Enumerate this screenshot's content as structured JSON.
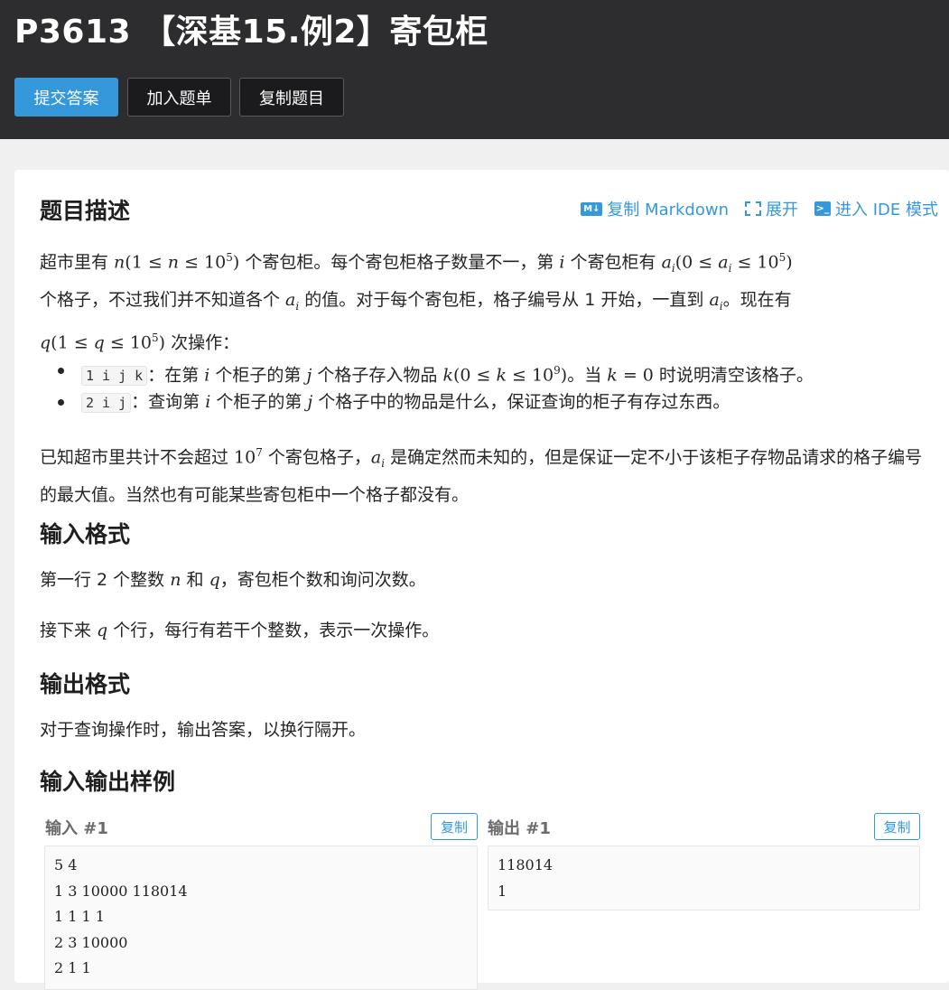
{
  "header": {
    "title": "P3613 【深基15.例2】寄包柜",
    "buttons": {
      "submit": "提交答案",
      "add_list": "加入题单",
      "copy_problem": "复制题目"
    }
  },
  "toolbar": {
    "copy_markdown": "复制 Markdown",
    "expand": "展开",
    "ide_mode": "进入 IDE 模式",
    "md_icon_text": "M↓",
    "term_icon_text": ">_"
  },
  "sections": {
    "description": "题目描述",
    "input_format": "输入格式",
    "output_format": "输出格式",
    "samples": "输入输出样例"
  },
  "description": {
    "p1": {
      "a": "超市里有 ",
      "n1": "n",
      "r1": "(1 ≤ ",
      "n2": "n",
      "r2": " ≤ 10",
      "exp1": "5",
      "r3": ")",
      "b": " 个寄包柜。每个寄包柜格子数量不一，第 ",
      "i": "i",
      "c": " 个寄包柜有 ",
      "ai": "a",
      "sub_i": "i",
      "r4": "(0 ≤ ",
      "ai2": "a",
      "sub_i2": "i",
      "r5": " ≤ 10",
      "exp2": "5",
      "r6": ")",
      "d": "个格子，不过我们并不知道各个 ",
      "ai3": "a",
      "sub_i3": "i",
      "e": " 的值。对于每个寄包柜，格子编号从 1 开始，一直到 ",
      "ai4": "a",
      "sub_i4": "i",
      "f": "。现在有",
      "q1": "q",
      "r7": "(1 ≤ ",
      "q2": "q",
      "r8": " ≤ 10",
      "exp3": "5",
      "r9": ")",
      "g": " 次操作："
    },
    "bullets": [
      {
        "code": "1 i j k",
        "a": "：在第 ",
        "v1": "i",
        "b": " 个柜子的第 ",
        "v2": "j",
        "c": " 个格子存入物品 ",
        "v3": "k",
        "r1": "(0 ≤ ",
        "v4": "k",
        "r2": " ≤ 10",
        "exp": "9",
        "r3": ")",
        "d": "。当 ",
        "v5": "k",
        "r4": " = 0",
        "e": " 时说明清空该格子。"
      },
      {
        "code": "2 i j",
        "a": "：查询第 ",
        "v1": "i",
        "b": " 个柜子的第 ",
        "v2": "j",
        "c": " 个格子中的物品是什么，保证查询的柜子有存过东西。"
      }
    ],
    "p2": {
      "a": "已知超市里共计不会超过 ",
      "base": "10",
      "exp": "7",
      "b": " 个寄包格子，",
      "ai": "a",
      "sub": "i",
      "c": " 是确定然而未知的，但是保证一定不小于该柜子存物品请求的格子编号的最大值。当然也有可能某些寄包柜中一个格子都没有。"
    }
  },
  "input_format": {
    "l1": {
      "a": "第一行 2 个整数 ",
      "n": "n",
      "b": " 和 ",
      "q": "q",
      "c": "，寄包柜个数和询问次数。"
    },
    "l2": {
      "a": "接下来 ",
      "q": "q",
      "b": " 个行，每行有若干个整数，表示一次操作。"
    }
  },
  "output_format": {
    "text": "对于查询操作时，输出答案，以换行隔开。"
  },
  "samples": {
    "input_label": "输入 #1",
    "output_label": "输出 #1",
    "copy_label": "复制",
    "input_lines": [
      "5 4",
      "1 3 10000 118014",
      "1 1 1 1",
      "2 3 10000",
      "2 1 1"
    ],
    "output_lines": [
      "118014",
      "1"
    ]
  }
}
